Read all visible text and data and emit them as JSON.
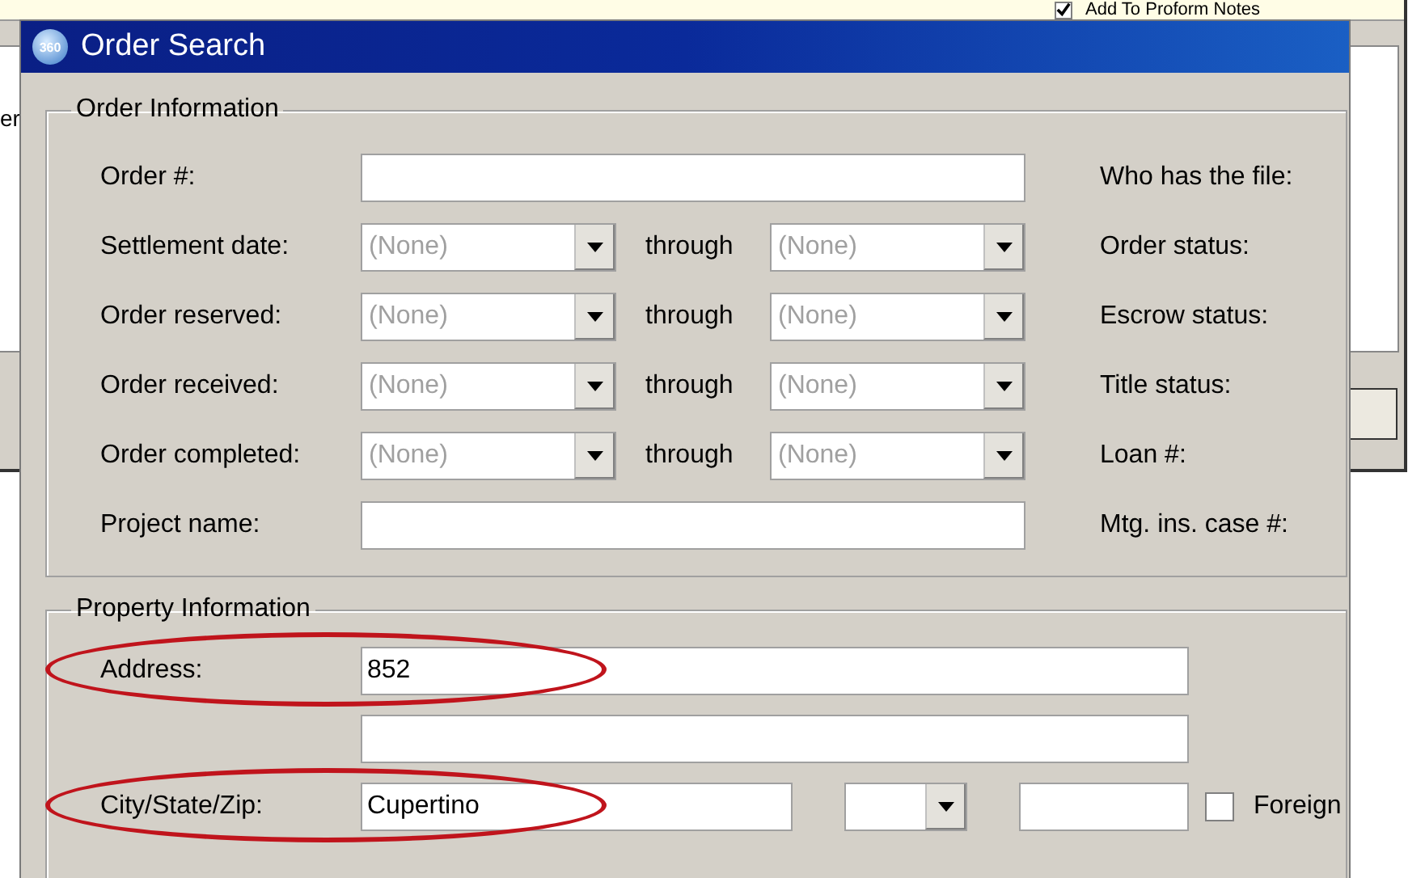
{
  "background_window": {
    "fragment": "er",
    "notes_checkbox": {
      "label": "Add To Proform Notes",
      "checked": true
    }
  },
  "window": {
    "logo_text": "360",
    "title": "Order Search"
  },
  "order_information": {
    "title": "Order Information",
    "rows": [
      {
        "kind": "text",
        "label": "Order #:",
        "side_label": "Who has the file:"
      },
      {
        "kind": "range",
        "label": "Settlement date:",
        "from": "(None)",
        "through": "through",
        "to": "(None)",
        "side_label": "Order status:"
      },
      {
        "kind": "range",
        "label": "Order reserved:",
        "from": "(None)",
        "through": "through",
        "to": "(None)",
        "side_label": "Escrow status:"
      },
      {
        "kind": "range",
        "label": "Order received:",
        "from": "(None)",
        "through": "through",
        "to": "(None)",
        "side_label": "Title status:"
      },
      {
        "kind": "range",
        "label": "Order completed:",
        "from": "(None)",
        "through": "through",
        "to": "(None)",
        "side_label": "Loan #:"
      },
      {
        "kind": "text",
        "label": "Project name:",
        "side_label": "Mtg. ins. case #:"
      }
    ]
  },
  "property_information": {
    "title": "Property Information",
    "rows": [
      {
        "kind": "text",
        "label": "Address:",
        "value": "852",
        "highlighted": true
      },
      {
        "kind": "text",
        "highlighted": false
      },
      {
        "kind": "city",
        "label": "City/State/Zip:",
        "city": "Cupertino",
        "highlighted": true,
        "foreign": {
          "label": "Foreign",
          "checked": false
        }
      }
    ]
  }
}
